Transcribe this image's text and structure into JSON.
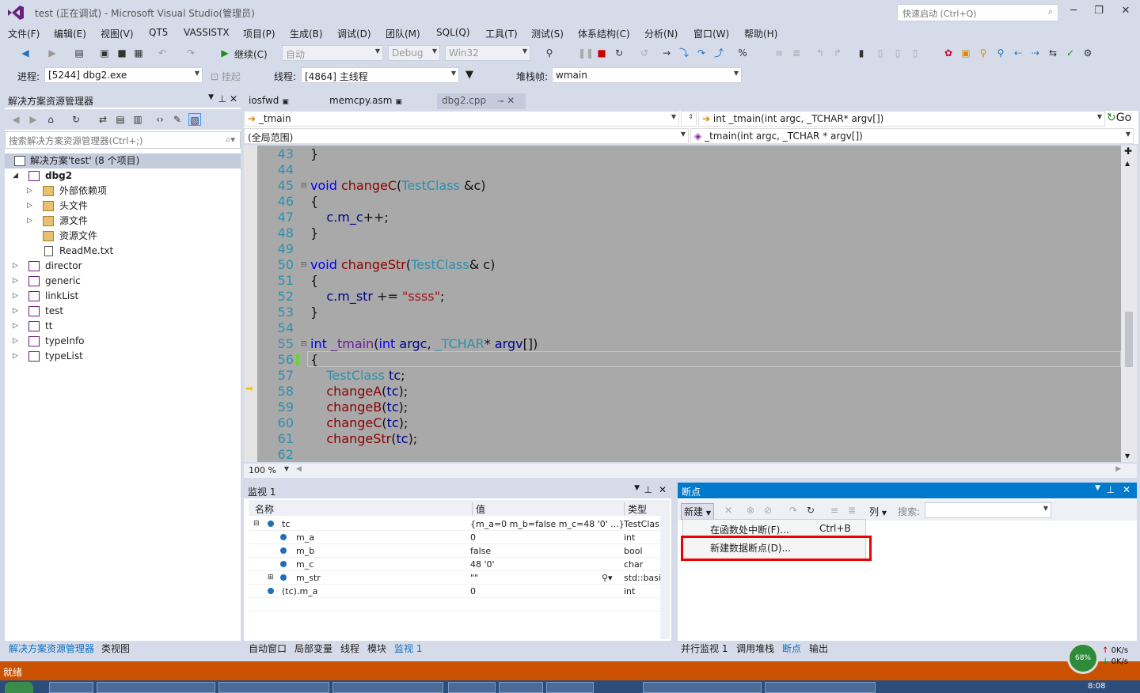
{
  "titlebar": {
    "title": "test (正在调试) - Microsoft Visual Studio(管理员)",
    "quick_launch": "快速启动 (Ctrl+Q)"
  },
  "menu": [
    "文件(F)",
    "编辑(E)",
    "视图(V)",
    "QT5",
    "VASSISTX",
    "项目(P)",
    "生成(B)",
    "调试(D)",
    "团队(M)",
    "SQL(Q)",
    "工具(T)",
    "测试(S)",
    "体系结构(C)",
    "分析(N)",
    "窗口(W)",
    "帮助(H)"
  ],
  "toolbar": {
    "continue": "继续(C)",
    "auto": "自动",
    "config": "Debug",
    "platform": "Win32"
  },
  "debugbar": {
    "process_label": "进程:",
    "process": "[5244] dbg2.exe",
    "suspend": "挂起",
    "thread_label": "线程:",
    "thread": "[4864] 主线程",
    "stack_label": "堆栈帧:",
    "stack": "wmain"
  },
  "solution": {
    "title": "解决方案资源管理器",
    "search": "搜索解决方案资源管理器(Ctrl+;)",
    "root": "解决方案'test' (8 个项目)",
    "items": [
      "dbg2",
      "外部依赖项",
      "头文件",
      "源文件",
      "资源文件",
      "ReadMe.txt",
      "director",
      "generic",
      "linkList",
      "test",
      "tt",
      "typeInfo",
      "typeList"
    ],
    "tabs": [
      "解决方案资源管理器",
      "类视图"
    ]
  },
  "editor": {
    "tabs": [
      "iosfwd",
      "memcpy.asm",
      "dbg2.cpp"
    ],
    "nav_left": "_tmain",
    "nav_right": "int _tmain(int argc, _TCHAR* argv[])",
    "scope": "(全局范围)",
    "scope_right": "_tmain(int argc, _TCHAR * argv[])",
    "go": "Go",
    "zoom": "100 %",
    "line_numbers": [
      "43",
      "44",
      "45",
      "46",
      "47",
      "48",
      "49",
      "50",
      "51",
      "52",
      "53",
      "54",
      "55",
      "56",
      "57",
      "58",
      "59",
      "60",
      "61",
      "62"
    ]
  },
  "watch": {
    "title": "监视 1",
    "columns": [
      "名称",
      "值",
      "类型"
    ],
    "rows": [
      {
        "name": "tc",
        "value": "{m_a=0 m_b=false m_c=48 '0' ...}",
        "type": "TestClas"
      },
      {
        "name": "m_a",
        "value": "0",
        "type": "int"
      },
      {
        "name": "m_b",
        "value": "false",
        "type": "bool"
      },
      {
        "name": "m_c",
        "value": "48 '0'",
        "type": "char"
      },
      {
        "name": "m_str",
        "value": "\"\"",
        "type": "std::basi"
      },
      {
        "name": "(tc).m_a",
        "value": "0",
        "type": "int"
      }
    ],
    "tabs": [
      "自动窗口",
      "局部变量",
      "线程",
      "模块",
      "监视 1"
    ]
  },
  "breakpoints": {
    "title": "断点",
    "new_btn": "新建",
    "cols_btn": "列",
    "search_label": "搜索:",
    "menu": [
      {
        "label": "在函数处中断(F)...",
        "shortcut": "Ctrl+B"
      },
      {
        "label": "新建数据断点(D)...",
        "shortcut": ""
      }
    ],
    "tabs": [
      "并行监视 1",
      "调用堆栈",
      "断点",
      "输出"
    ]
  },
  "status": {
    "text": "就绪",
    "net_percent": "68%",
    "up": "0K/s",
    "down": "0K/s",
    "time": "8:08"
  },
  "colors": {
    "accent": "#007acc",
    "status": "#ca5100",
    "highlight": "#e00000"
  }
}
